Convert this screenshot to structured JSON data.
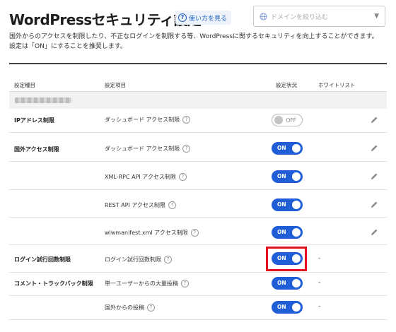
{
  "header": {
    "title": "WordPressセキュリティ設定",
    "help_label": "使い方を見る",
    "domain_placeholder": "ドメインを絞り込む"
  },
  "description": {
    "line1": "国外からのアクセスを制限したり、不正なログインを制限する等、WordPressに関するセキュリティを向上することができます。",
    "line2": "設定は「ON」にすることを推奨します。"
  },
  "table": {
    "headers": {
      "category": "設定種目",
      "item": "設定項目",
      "status": "設定状況",
      "whitelist": "ホワイトリスト"
    },
    "categories": {
      "ip": "IPアドレス制限",
      "foreign": "国外アクセス制限",
      "login": "ログイン試行回数制限",
      "comment": "コメント・トラックバック制限"
    },
    "items": [
      {
        "label": "ダッシュボード アクセス制限",
        "status": "OFF"
      },
      {
        "label": "ダッシュボード アクセス制限",
        "status": "ON"
      },
      {
        "label": "XML-RPC API アクセス制限",
        "status": "ON"
      },
      {
        "label": "REST API アクセス制限",
        "status": "ON"
      },
      {
        "label": "wlwmanifest.xml アクセス制限",
        "status": "ON"
      },
      {
        "label": "ログイン試行回数制限",
        "status": "ON",
        "whitelist": "-"
      },
      {
        "label": "単一ユーザーからの大量投稿",
        "status": "ON",
        "whitelist": "-"
      },
      {
        "label": "国外からの投稿",
        "status": "ON",
        "whitelist": "-"
      }
    ]
  },
  "colors": {
    "toggle_on": "#1f5ed6",
    "highlight": "#e3101d"
  }
}
